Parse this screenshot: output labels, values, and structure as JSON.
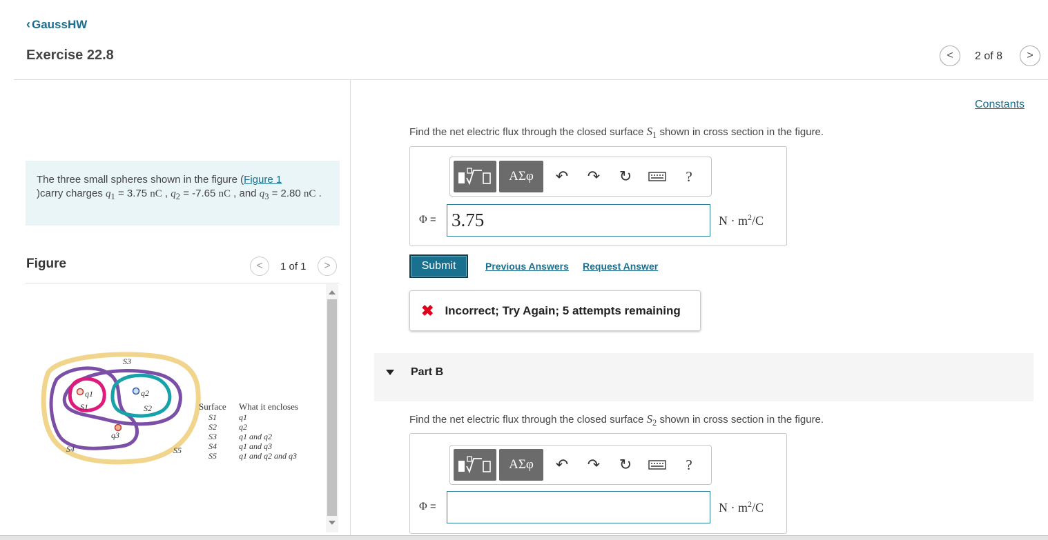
{
  "header": {
    "back_label": "GaussHW",
    "exercise_title": "Exercise 22.8",
    "pager": "2 of 8"
  },
  "problem": {
    "text_1": "The three small spheres shown in the figure (",
    "figure_link": "Figure 1",
    "text_2": ")carry charges ",
    "q1_sym": "q",
    "q1_sub": "1",
    "eq1": " = 3.75 ",
    "unit1": "nC",
    "sep1": " , ",
    "q2_sym": "q",
    "q2_sub": "2",
    "eq2": " = -7.65 ",
    "unit2": "nC",
    "sep2": " , and ",
    "q3_sym": "q",
    "q3_sub": "3",
    "eq3": " = 2.80 ",
    "unit3": "nC",
    "end": " ."
  },
  "figure": {
    "label": "Figure",
    "pager": "1 of 1",
    "table_header_surface": "Surface",
    "table_header_encloses": "What it encloses",
    "rows": [
      {
        "surface": "S1",
        "encloses": "q1"
      },
      {
        "surface": "S2",
        "encloses": "q2"
      },
      {
        "surface": "S3",
        "encloses": "q1 and q2"
      },
      {
        "surface": "S4",
        "encloses": "q1 and q3"
      },
      {
        "surface": "S5",
        "encloses": "q1 and q2 and q3"
      }
    ],
    "labels": {
      "S1": "S1",
      "S2": "S2",
      "S3": "S3",
      "S4": "S4",
      "S5": "S5",
      "q1": "q1",
      "q2": "q2",
      "q3": "q3"
    },
    "colors": {
      "S1": "#e0197d",
      "S2": "#16a2a8",
      "S3": "#7b4fa6",
      "S4": "#7b4fa6",
      "S5": "#f2d58c"
    }
  },
  "constants_link": "Constants",
  "partA": {
    "question_pre": "Find the net electric flux through the closed surface ",
    "surface_sym": "S",
    "surface_sub": "1",
    "question_post": " shown in cross section in the figure.",
    "phi_symbol": "Φ",
    "phi_eq": " =",
    "value": "3.75",
    "units_pre": "N · m",
    "units_sup": "2",
    "units_post": "/C",
    "greek_button": "ΑΣφ",
    "help_icon": "?",
    "submit_label": "Submit",
    "previous_answers": "Previous Answers",
    "request_answer": "Request Answer",
    "feedback": "Incorrect; Try Again; 5 attempts remaining"
  },
  "partB": {
    "title": "Part B",
    "question_pre": "Find the net electric flux through the closed surface ",
    "surface_sym": "S",
    "surface_sub": "2",
    "question_post": " shown in cross section in the figure.",
    "phi_symbol": "Φ",
    "phi_eq": " =",
    "value": "",
    "units_pre": "N · m",
    "units_sup": "2",
    "units_post": "/C",
    "greek_button": "ΑΣφ",
    "help_icon": "?"
  }
}
